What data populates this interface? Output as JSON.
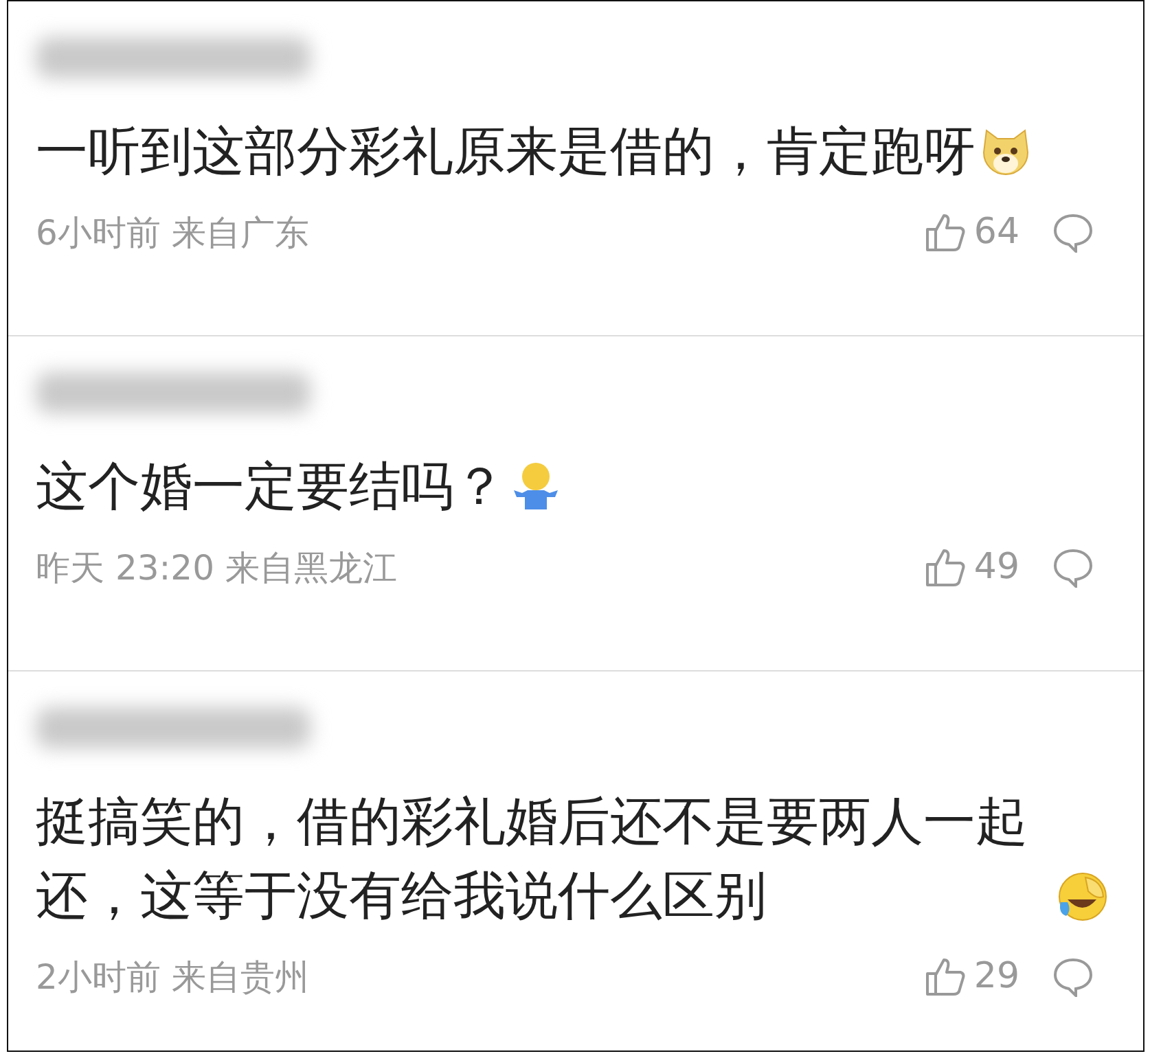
{
  "comments": [
    {
      "author_hidden": true,
      "text": "一听到这部分彩礼原来是借的，肯定跑呀",
      "trailing_icon": {
        "kind": "dog"
      },
      "time": "6小时前",
      "location": "来自广东",
      "likes": "64"
    },
    {
      "author_hidden": true,
      "text": "这个婚一定要结吗？",
      "trailing_icon": {
        "kind": "shrug"
      },
      "time": "昨天 23:20",
      "location": "来自黑龙江",
      "likes": "49"
    },
    {
      "author_hidden": true,
      "text": "挺搞笑的，借的彩礼婚后还不是要两人一起还，这等于没有给我说什么区别",
      "trailing_icon": {
        "kind": "laugh"
      },
      "time": "2小时前",
      "location": "来自贵州",
      "likes": "29"
    }
  ]
}
